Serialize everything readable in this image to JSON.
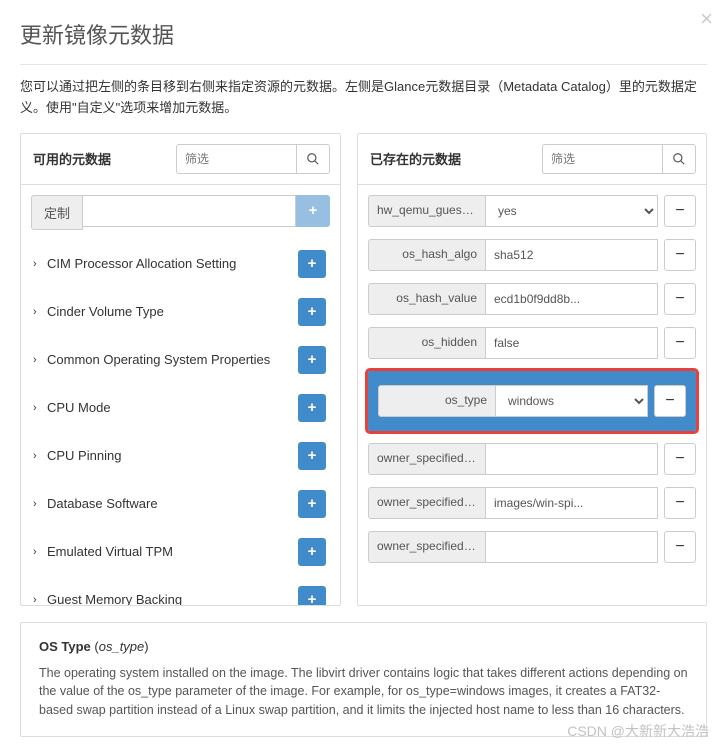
{
  "modal": {
    "title": "更新镜像元数据",
    "description": "您可以通过把左侧的条目移到右侧来指定资源的元数据。左侧是Glance元数据目录（Metadata Catalog）里的元数据定义。使用\"自定义\"选项来增加元数据。"
  },
  "available": {
    "title": "可用的元数据",
    "filter_placeholder": "筛选",
    "custom_label": "定制",
    "items": [
      {
        "label": "CIM Processor Allocation Setting"
      },
      {
        "label": "Cinder Volume Type"
      },
      {
        "label": "Common Operating System Properties"
      },
      {
        "label": "CPU Mode"
      },
      {
        "label": "CPU Pinning"
      },
      {
        "label": "Database Software"
      },
      {
        "label": "Emulated Virtual TPM"
      },
      {
        "label": "Guest Memory Backing"
      }
    ]
  },
  "existing": {
    "title": "已存在的元数据",
    "filter_placeholder": "筛选",
    "items": [
      {
        "key": "hw_qemu_guest_ag...",
        "value": "yes",
        "type": "select"
      },
      {
        "key": "os_hash_algo",
        "value": "sha512",
        "type": "text"
      },
      {
        "key": "os_hash_value",
        "value": "ecd1b0f9dd8b...",
        "type": "text"
      },
      {
        "key": "os_hidden",
        "value": "false",
        "type": "text"
      },
      {
        "key": "os_type",
        "value": "windows",
        "type": "select",
        "highlight": true
      },
      {
        "key": "owner_specified.op...",
        "value": "",
        "type": "text"
      },
      {
        "key": "owner_specified.op...",
        "value": "images/win-spi...",
        "type": "text"
      },
      {
        "key": "owner_specified.op...",
        "value": "",
        "type": "text"
      }
    ]
  },
  "detail": {
    "title_prefix": "OS Type",
    "title_key": "os_type",
    "body": "The operating system installed on the image. The libvirt driver contains logic that takes different actions depending on the value of the os_type parameter of the image. For example, for os_type=windows images, it creates a FAT32-based swap partition instead of a Linux swap partition, and it limits the injected host name to less than 16 characters."
  },
  "watermark": "CSDN @大新新大浩浩"
}
